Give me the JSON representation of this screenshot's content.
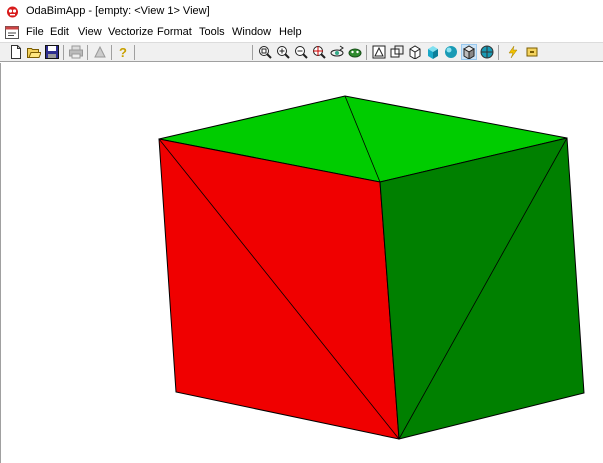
{
  "window": {
    "title": "OdaBimApp - [empty: <View 1> View]"
  },
  "menu": {
    "items": [
      {
        "label": "File"
      },
      {
        "label": "Edit"
      },
      {
        "label": "View"
      },
      {
        "label": "Vectorize"
      },
      {
        "label": "Format"
      },
      {
        "label": "Tools"
      },
      {
        "label": "Window"
      },
      {
        "label": "Help"
      }
    ]
  },
  "toolbar": {
    "left_icons": [
      "new-document-icon",
      "open-folder-icon",
      "save-icon",
      "print-icon",
      "print-preview-icon",
      "help-icon"
    ],
    "right_icons": [
      "zoom-window-icon",
      "zoom-in-icon",
      "zoom-out-icon",
      "zoom-extents-icon",
      "orbit-icon",
      "walk-icon",
      "2d-wireframe-icon",
      "3d-wireframe-icon",
      "hidden-line-icon",
      "flat-shaded-icon",
      "gouraud-shaded-icon",
      "shaded-edges-icon",
      "render-mode-icon",
      "lightning-icon",
      "lights-icon"
    ],
    "active_icon": "shaded-edges-icon"
  },
  "scene": {
    "background": "#ffffff",
    "cube_colors": {
      "left_face": "#ff0000",
      "right_face": "#008000",
      "top_face": "#00cc00",
      "edge": "#000000"
    }
  }
}
